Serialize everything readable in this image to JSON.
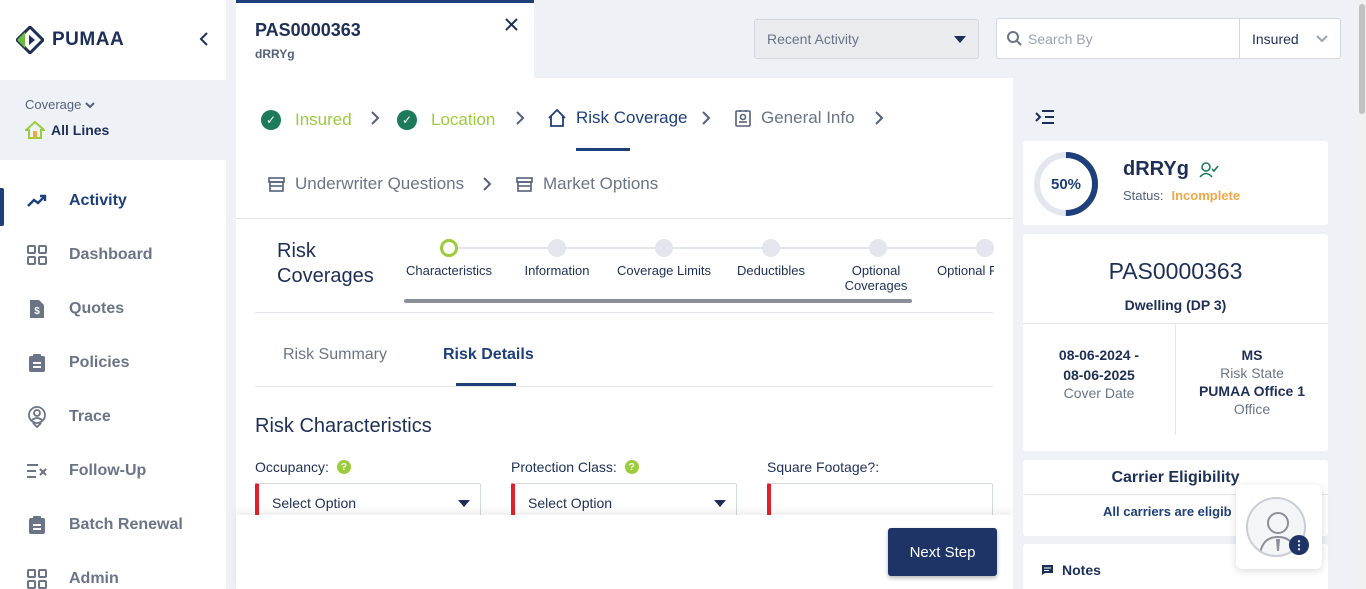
{
  "brand": {
    "name": "PUMAA"
  },
  "coverage": {
    "label": "Coverage",
    "value": "All Lines"
  },
  "nav": [
    {
      "label": "Activity",
      "icon": "trend-icon"
    },
    {
      "label": "Dashboard",
      "icon": "grid-icon"
    },
    {
      "label": "Quotes",
      "icon": "dollar-doc-icon"
    },
    {
      "label": "Policies",
      "icon": "clipboard-icon"
    },
    {
      "label": "Trace",
      "icon": "location-user-icon"
    },
    {
      "label": "Follow-Up",
      "icon": "list-check-icon"
    },
    {
      "label": "Batch Renewal",
      "icon": "clipboard-icon"
    },
    {
      "label": "Admin",
      "icon": "grid-icon"
    }
  ],
  "tab": {
    "id": "PAS0000363",
    "subtitle": "dRRYg"
  },
  "recent_activity": {
    "label": "Recent Activity"
  },
  "search": {
    "placeholder": "Search By",
    "type": "Insured"
  },
  "steps": [
    {
      "label": "Insured",
      "state": "done"
    },
    {
      "label": "Location",
      "state": "done"
    },
    {
      "label": "Risk Coverage",
      "state": "current"
    },
    {
      "label": "General Info",
      "state": "pending"
    },
    {
      "label": "Underwriter Questions",
      "state": "pending"
    },
    {
      "label": "Market Options",
      "state": "pending"
    }
  ],
  "risk_coverages": {
    "title_line1": "Risk",
    "title_line2": "Coverages",
    "progress": [
      {
        "label": "Characteristics",
        "active": true
      },
      {
        "label": "Information"
      },
      {
        "label": "Coverage Limits"
      },
      {
        "label": "Deductibles"
      },
      {
        "label": "Optional Coverages"
      },
      {
        "label": "Optional Pa"
      }
    ]
  },
  "subtabs": {
    "summary": "Risk Summary",
    "details": "Risk Details"
  },
  "section": {
    "title": "Risk Characteristics",
    "occupancy_label": "Occupancy:",
    "protection_label": "Protection Class:",
    "sqft_label": "Square Footage?:",
    "select_placeholder": "Select Option"
  },
  "next_step": "Next Step",
  "summary_card": {
    "name": "dRRYg",
    "percent": "50%",
    "percent_value": 0.5,
    "status_label": "Status:",
    "status_value": "Incomplete"
  },
  "policy_card": {
    "id": "PAS0000363",
    "type": "Dwelling (DP 3)",
    "date_start": "08-06-2024 -",
    "date_end": "08-06-2025",
    "date_label": "Cover Date",
    "state": "MS",
    "state_label": "Risk State",
    "office": "PUMAA Office 1",
    "office_label": "Office"
  },
  "carrier": {
    "title": "Carrier Eligibility",
    "message": "All carriers are eligib"
  },
  "notes": {
    "title": "Notes"
  },
  "colors": {
    "primary": "#1e3f7a",
    "done": "#9ccc3c",
    "warning": "#f0a84a",
    "required": "#e0202a"
  }
}
